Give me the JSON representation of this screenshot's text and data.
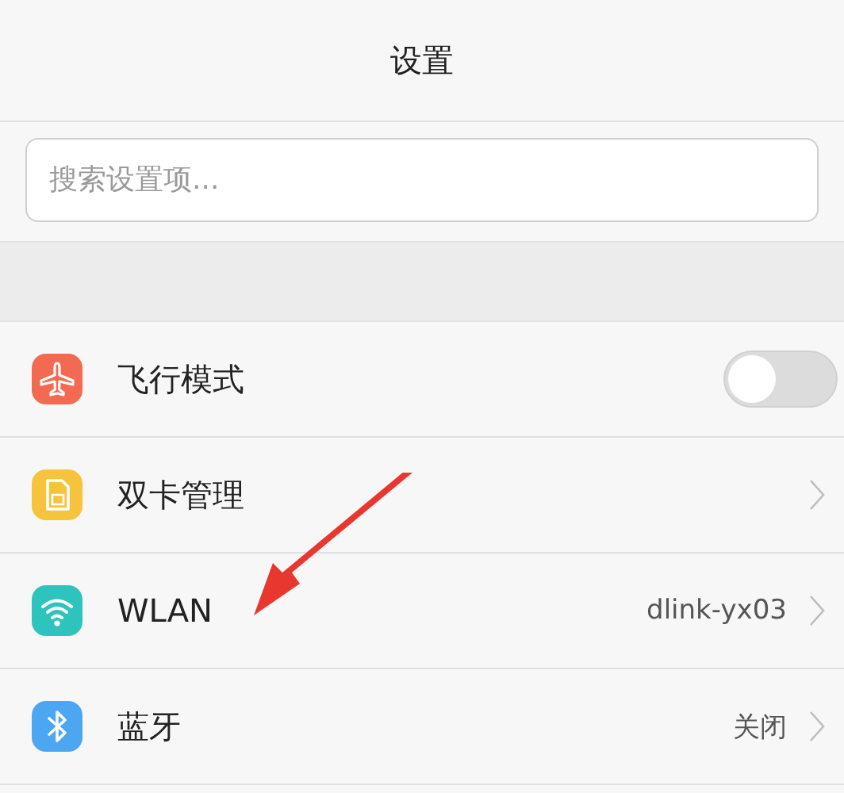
{
  "header": {
    "title": "设置"
  },
  "search": {
    "placeholder": "搜索设置项..."
  },
  "rows": [
    {
      "kind": "toggle",
      "color": "#f26a52",
      "label": "飞行模式",
      "on": false
    },
    {
      "kind": "link",
      "color": "#f6c33c",
      "label": "双卡管理"
    },
    {
      "kind": "link",
      "color": "#2fc3bd",
      "label": "WLAN",
      "value": "dlink-yx03"
    },
    {
      "kind": "link",
      "color": "#4da6f2",
      "label": "蓝牙",
      "value": "关闭"
    }
  ]
}
